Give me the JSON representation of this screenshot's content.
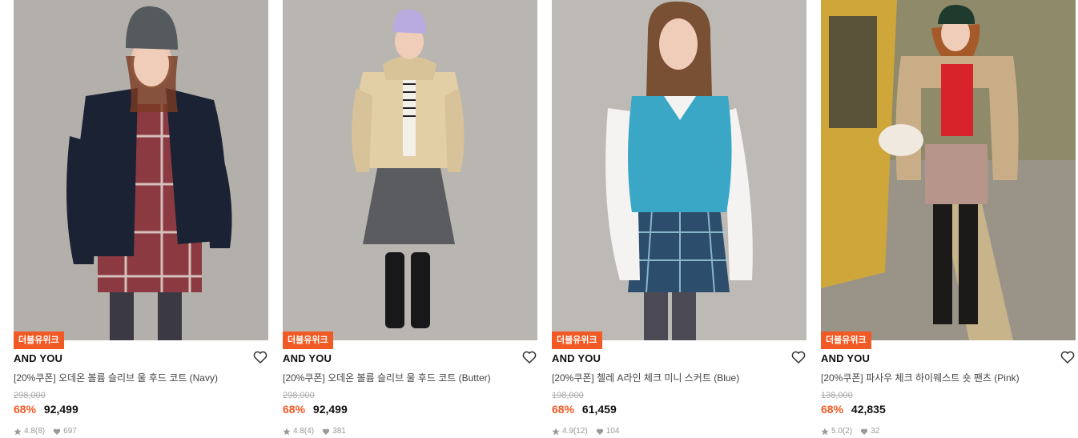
{
  "products": [
    {
      "badge": "더블유위크",
      "brand": "AND YOU",
      "title": "[20%쿠폰] 오데온 볼륨 슬리브 울 후드 코트 (Navy)",
      "original_price": "298,000",
      "discount": "68%",
      "price": "92,499",
      "rating": "4.8",
      "reviews": "(8)",
      "likes": "697",
      "colors": {
        "bg": "#b3afab",
        "coat": "#1a2233",
        "accent": "#7a2b33",
        "hat": "#555a5c"
      }
    },
    {
      "badge": "더블유위크",
      "brand": "AND YOU",
      "title": "[20%쿠폰] 오데온 볼륨 슬리브 울 후드 코트 (Butter)",
      "original_price": "298,000",
      "discount": "68%",
      "price": "92,499",
      "rating": "4.8",
      "reviews": "(4)",
      "likes": "381",
      "colors": {
        "bg": "#b9b5b0",
        "coat": "#e2cfa6",
        "accent": "#5b5c60",
        "hat": "#b9aadf"
      }
    },
    {
      "badge": "더블유위크",
      "brand": "AND YOU",
      "title": "[20%쿠폰] 첼레 A라인 체크 미니 스커트 (Blue)",
      "original_price": "198,000",
      "discount": "68%",
      "price": "61,459",
      "rating": "4.9",
      "reviews": "(12)",
      "likes": "104",
      "colors": {
        "bg": "#bdbab6",
        "coat": "#3aa7c7",
        "accent": "#2c4d6b",
        "hat": "#7a5034"
      }
    },
    {
      "badge": "더블유위크",
      "brand": "AND YOU",
      "title": "[20%쿠폰] 파사우 체크 하이웨스트 숏 팬츠 (Pink)",
      "original_price": "138,000",
      "discount": "68%",
      "price": "42,835",
      "rating": "5.0",
      "reviews": "(2)",
      "likes": "32",
      "colors": {
        "bg": "#8e8a6a",
        "coat": "#c9ad86",
        "accent": "#d8232a",
        "hat": "#1f3b2d"
      }
    }
  ]
}
